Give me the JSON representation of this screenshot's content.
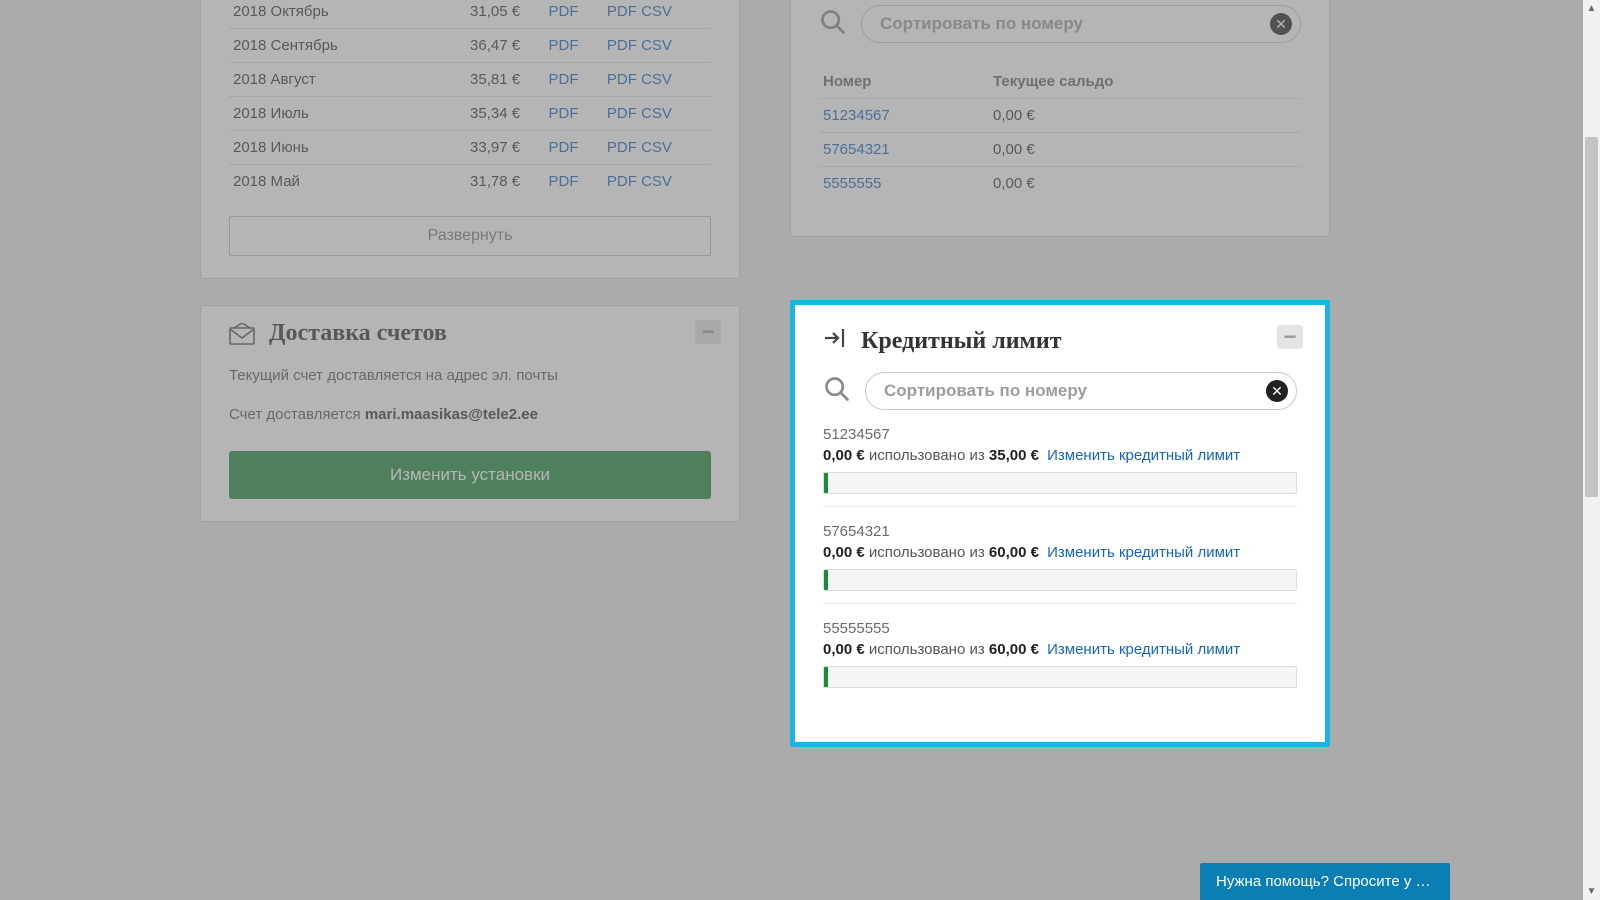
{
  "invoices": {
    "rows": [
      {
        "period": "2018 Октябрь",
        "amount": "31,05 €"
      },
      {
        "period": "2018 Сентябрь",
        "amount": "36,47 €"
      },
      {
        "period": "2018 Август",
        "amount": "35,81 €"
      },
      {
        "period": "2018 Июль",
        "amount": "35,34 €"
      },
      {
        "period": "2018 Июнь",
        "amount": "33,97 €"
      },
      {
        "period": "2018 Май",
        "amount": "31,78 €"
      }
    ],
    "pdf_label": "PDF",
    "csv_label": "CSV",
    "expand_label": "Развернуть"
  },
  "delivery": {
    "title": "Доставка счетов",
    "line1": "Текущий счет доставляется на адрес эл. почты",
    "line2_prefix": "Счет доставляется ",
    "email": "mari.maasikas@tele2.ee",
    "change_btn": "Изменить установки"
  },
  "balances": {
    "search_placeholder": "Сортировать по номеру",
    "col_number": "Номер",
    "col_balance": "Текущее сальдо",
    "rows": [
      {
        "number": "51234567",
        "balance": "0,00 €"
      },
      {
        "number": "57654321",
        "balance": "0,00 €"
      },
      {
        "number": "5555555",
        "balance": "0,00 €"
      }
    ]
  },
  "credit": {
    "title": "Кредитный лимит",
    "search_placeholder": "Сортировать по номеру",
    "used_word": "использовано из",
    "change_link": "Изменить кредитный лимит",
    "items": [
      {
        "number": "51234567",
        "used": "0,00 €",
        "limit": "35,00 €"
      },
      {
        "number": "57654321",
        "used": "0,00 €",
        "limit": "60,00 €"
      },
      {
        "number": "55555555",
        "used": "0,00 €",
        "limit": "60,00 €"
      }
    ]
  },
  "help_tab": "Нужна помощь? Спросите у консул..."
}
